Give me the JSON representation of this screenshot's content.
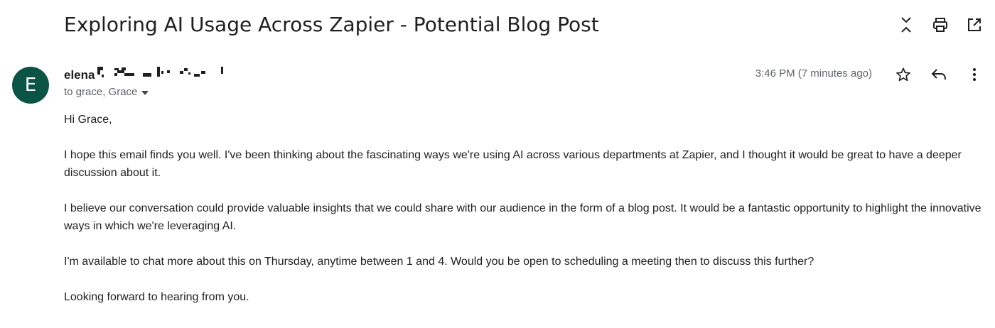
{
  "email": {
    "subject": "Exploring AI Usage Across Zapier - Potential Blog Post",
    "sender_name": "elena",
    "avatar_initial": "E",
    "avatar_color": "#0b5345",
    "recipients": "to grace, Grace",
    "timestamp": "3:46 PM (7 minutes ago)",
    "body": {
      "greeting": "Hi Grace,",
      "paragraph_1": "I hope this email finds you well. I've been thinking about the fascinating ways we're using AI across various departments at Zapier, and I thought it would be great to have a deeper discussion about it.",
      "paragraph_2": "I believe our conversation could provide valuable insights that we could share with our audience in the form of a blog post. It would be a fantastic opportunity to highlight the innovative ways in which we're leveraging AI.",
      "paragraph_3": "I'm available to chat more about this on Thursday, anytime between 1 and 4. Would you be open to scheduling a meeting then to discuss this further?",
      "closing": "Looking forward to hearing from you."
    }
  },
  "icons": {
    "collapse": "collapse-all-icon",
    "print": "print-icon",
    "open_new_window": "open-in-new-window-icon",
    "star": "star-icon",
    "reply": "reply-icon",
    "more": "more-vert-icon",
    "dropdown": "chevron-down-icon"
  }
}
